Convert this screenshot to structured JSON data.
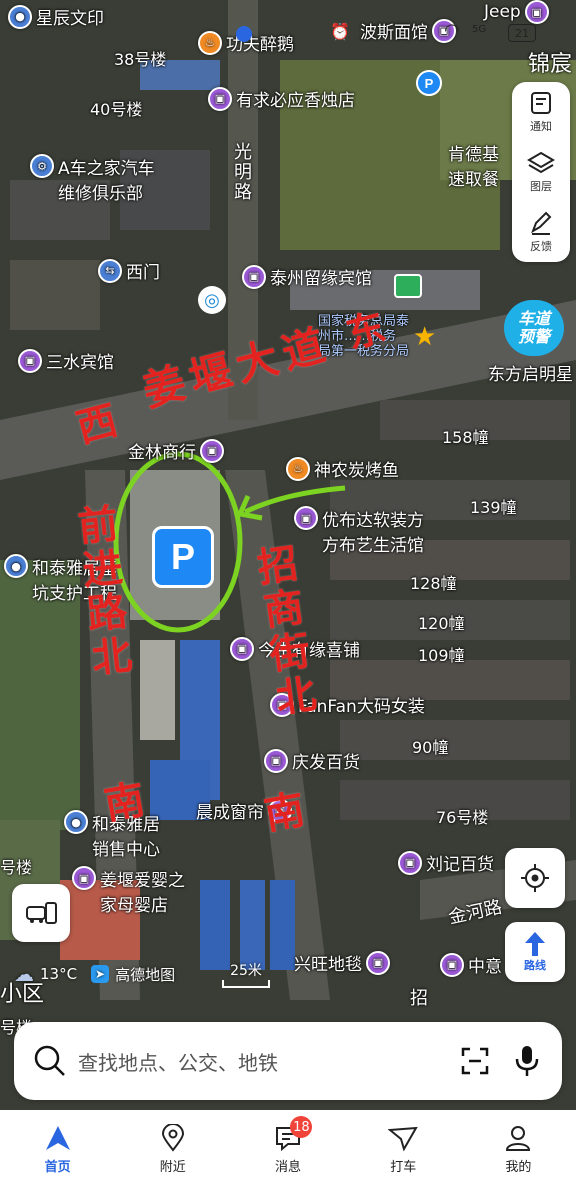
{
  "status_bar": {
    "battery": "21",
    "network": "5G"
  },
  "map_pois": [
    {
      "id": "xingchen",
      "label": "星辰文印",
      "pin": "blue"
    },
    {
      "id": "gongfu",
      "label": "功夫醉鹅",
      "pin": "orange"
    },
    {
      "id": "bosi",
      "label": "波斯面馆",
      "pin": "purple"
    },
    {
      "id": "jeep",
      "label": "Jeep",
      "pin": "purple"
    },
    {
      "id": "youqiu",
      "label": "有求必应香烛店",
      "pin": "purple"
    },
    {
      "id": "acar",
      "label": "A车之家汽车\n维修俱乐部",
      "pin": "blue"
    },
    {
      "id": "kendeji",
      "label": "肯德基\n速取餐",
      "pin": "none"
    },
    {
      "id": "ximen",
      "label": "西门",
      "pin": "blue"
    },
    {
      "id": "taizhou",
      "label": "泰州留缘宾馆",
      "pin": "purple"
    },
    {
      "id": "sanshui",
      "label": "三水宾馆",
      "pin": "purple"
    },
    {
      "id": "shuiwu",
      "label": "国家税务总局泰\n州市……税务\n局第一税务分局",
      "pin": "star"
    },
    {
      "id": "dongfang",
      "label": "东方启明星",
      "pin": "none"
    },
    {
      "id": "jinlin",
      "label": "金林商行",
      "pin": "purple"
    },
    {
      "id": "shennong",
      "label": "神农炭烤鱼",
      "pin": "orange"
    },
    {
      "id": "youbuda",
      "label": "优布达软装方\n方布艺生活馆",
      "pin": "purple"
    },
    {
      "id": "hetai",
      "label": "和泰雅居基\n坑支护工程",
      "pin": "blue"
    },
    {
      "id": "youyuan",
      "label": "今生有缘喜铺",
      "pin": "purple"
    },
    {
      "id": "fanfan",
      "label": "FanFan大码女装",
      "pin": "purple"
    },
    {
      "id": "qingfa",
      "label": "庆发百货",
      "pin": "purple"
    },
    {
      "id": "chencheng",
      "label": "晨成窗帘",
      "pin": "purple"
    },
    {
      "id": "hetaiju",
      "label": "和泰雅居\n销售中心",
      "pin": "blue"
    },
    {
      "id": "liuji",
      "label": "刘记百货",
      "pin": "purple"
    },
    {
      "id": "jiangyan",
      "label": "姜堰爱婴之\n家母婴店",
      "pin": "purple"
    },
    {
      "id": "xingwang",
      "label": "兴旺地毯",
      "pin": "purple"
    },
    {
      "id": "zhongyi",
      "label": "中意",
      "pin": "purple"
    }
  ],
  "buildings": [
    "38号楼",
    "40号楼",
    "158幢",
    "139幢",
    "128幢",
    "120幢",
    "109幢",
    "90幢",
    "76号楼",
    "号楼",
    "号楼"
  ],
  "roads": {
    "guangming": "光明路",
    "jinhe": "金河路",
    "zhao": "招",
    "chedao": "车道\n预警",
    "jinxian": "锦宸",
    "xiaoqu": "小区"
  },
  "annotations": {
    "dong": "东",
    "jiangyan": "姜堰大道",
    "xi": "西",
    "qianjin": "前进路北",
    "zhaoshang": "招商街北",
    "nan1": "南",
    "nan2": "南"
  },
  "side_panel": [
    {
      "label": "通知",
      "icon": "notice-icon"
    },
    {
      "label": "图层",
      "icon": "layers-icon"
    },
    {
      "label": "反馈",
      "icon": "feedback-icon"
    }
  ],
  "route_button": "路线",
  "weather": {
    "temp": "13°C"
  },
  "logo_text": "高德地图",
  "scale": "25米",
  "search": {
    "placeholder": "查找地点、公交、地铁"
  },
  "tabs": [
    {
      "label": "首页",
      "icon": "home-icon",
      "active": true
    },
    {
      "label": "附近",
      "icon": "nearby-icon",
      "active": false
    },
    {
      "label": "消息",
      "icon": "message-icon",
      "active": false,
      "badge": "18"
    },
    {
      "label": "打车",
      "icon": "taxi-icon",
      "active": false
    },
    {
      "label": "我的",
      "icon": "profile-icon",
      "active": false
    }
  ],
  "colors": {
    "accent": "#2a66e0",
    "annotation_red": "#e3231f",
    "circle_green": "#7dd321",
    "parking_blue": "#1e88f5"
  }
}
